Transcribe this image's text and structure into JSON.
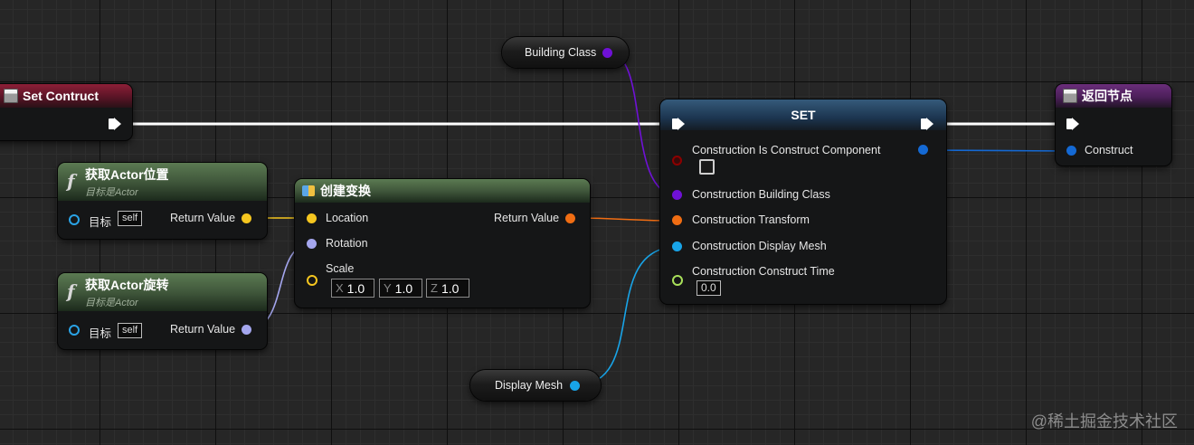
{
  "nodes": {
    "event": {
      "title": "Set Contruct"
    },
    "get_location": {
      "title": "获取Actor位置",
      "subtitle": "目标是Actor",
      "target_label": "目标",
      "target_value": "self",
      "return_label": "Return Value"
    },
    "get_rotation": {
      "title": "获取Actor旋转",
      "subtitle": "目标是Actor",
      "target_label": "目标",
      "target_value": "self",
      "return_label": "Return Value"
    },
    "make_transform": {
      "title": "创建变换",
      "location_label": "Location",
      "rotation_label": "Rotation",
      "scale_label": "Scale",
      "return_label": "Return Value",
      "scale": {
        "x_axis": "X",
        "x": "1.0",
        "y_axis": "Y",
        "y": "1.0",
        "z_axis": "Z",
        "z": "1.0"
      }
    },
    "set": {
      "title": "SET",
      "pins": {
        "is_construct_component": "Construction Is Construct Component",
        "building_class": "Construction Building Class",
        "transform": "Construction Transform",
        "display_mesh": "Construction Display Mesh",
        "construct_time": "Construction Construct Time"
      },
      "construct_time_value": "0.0"
    },
    "return": {
      "title": "返回节点",
      "construct_label": "Construct"
    },
    "building_class_var": {
      "label": "Building Class"
    },
    "display_mesh_var": {
      "label": "Display Mesh"
    }
  },
  "colors": {
    "exec": "#ffffff",
    "vector": "#f5c61f",
    "rotator": "#a4a6ee",
    "transform": "#f06d13",
    "class": "#6f11d6",
    "object": "#18a4e8",
    "struct": "#1469d4",
    "float": "#a8e05a",
    "bool": "#8b0000",
    "target": "#2aa3e6"
  },
  "watermark": "@稀土掘金技术社区"
}
